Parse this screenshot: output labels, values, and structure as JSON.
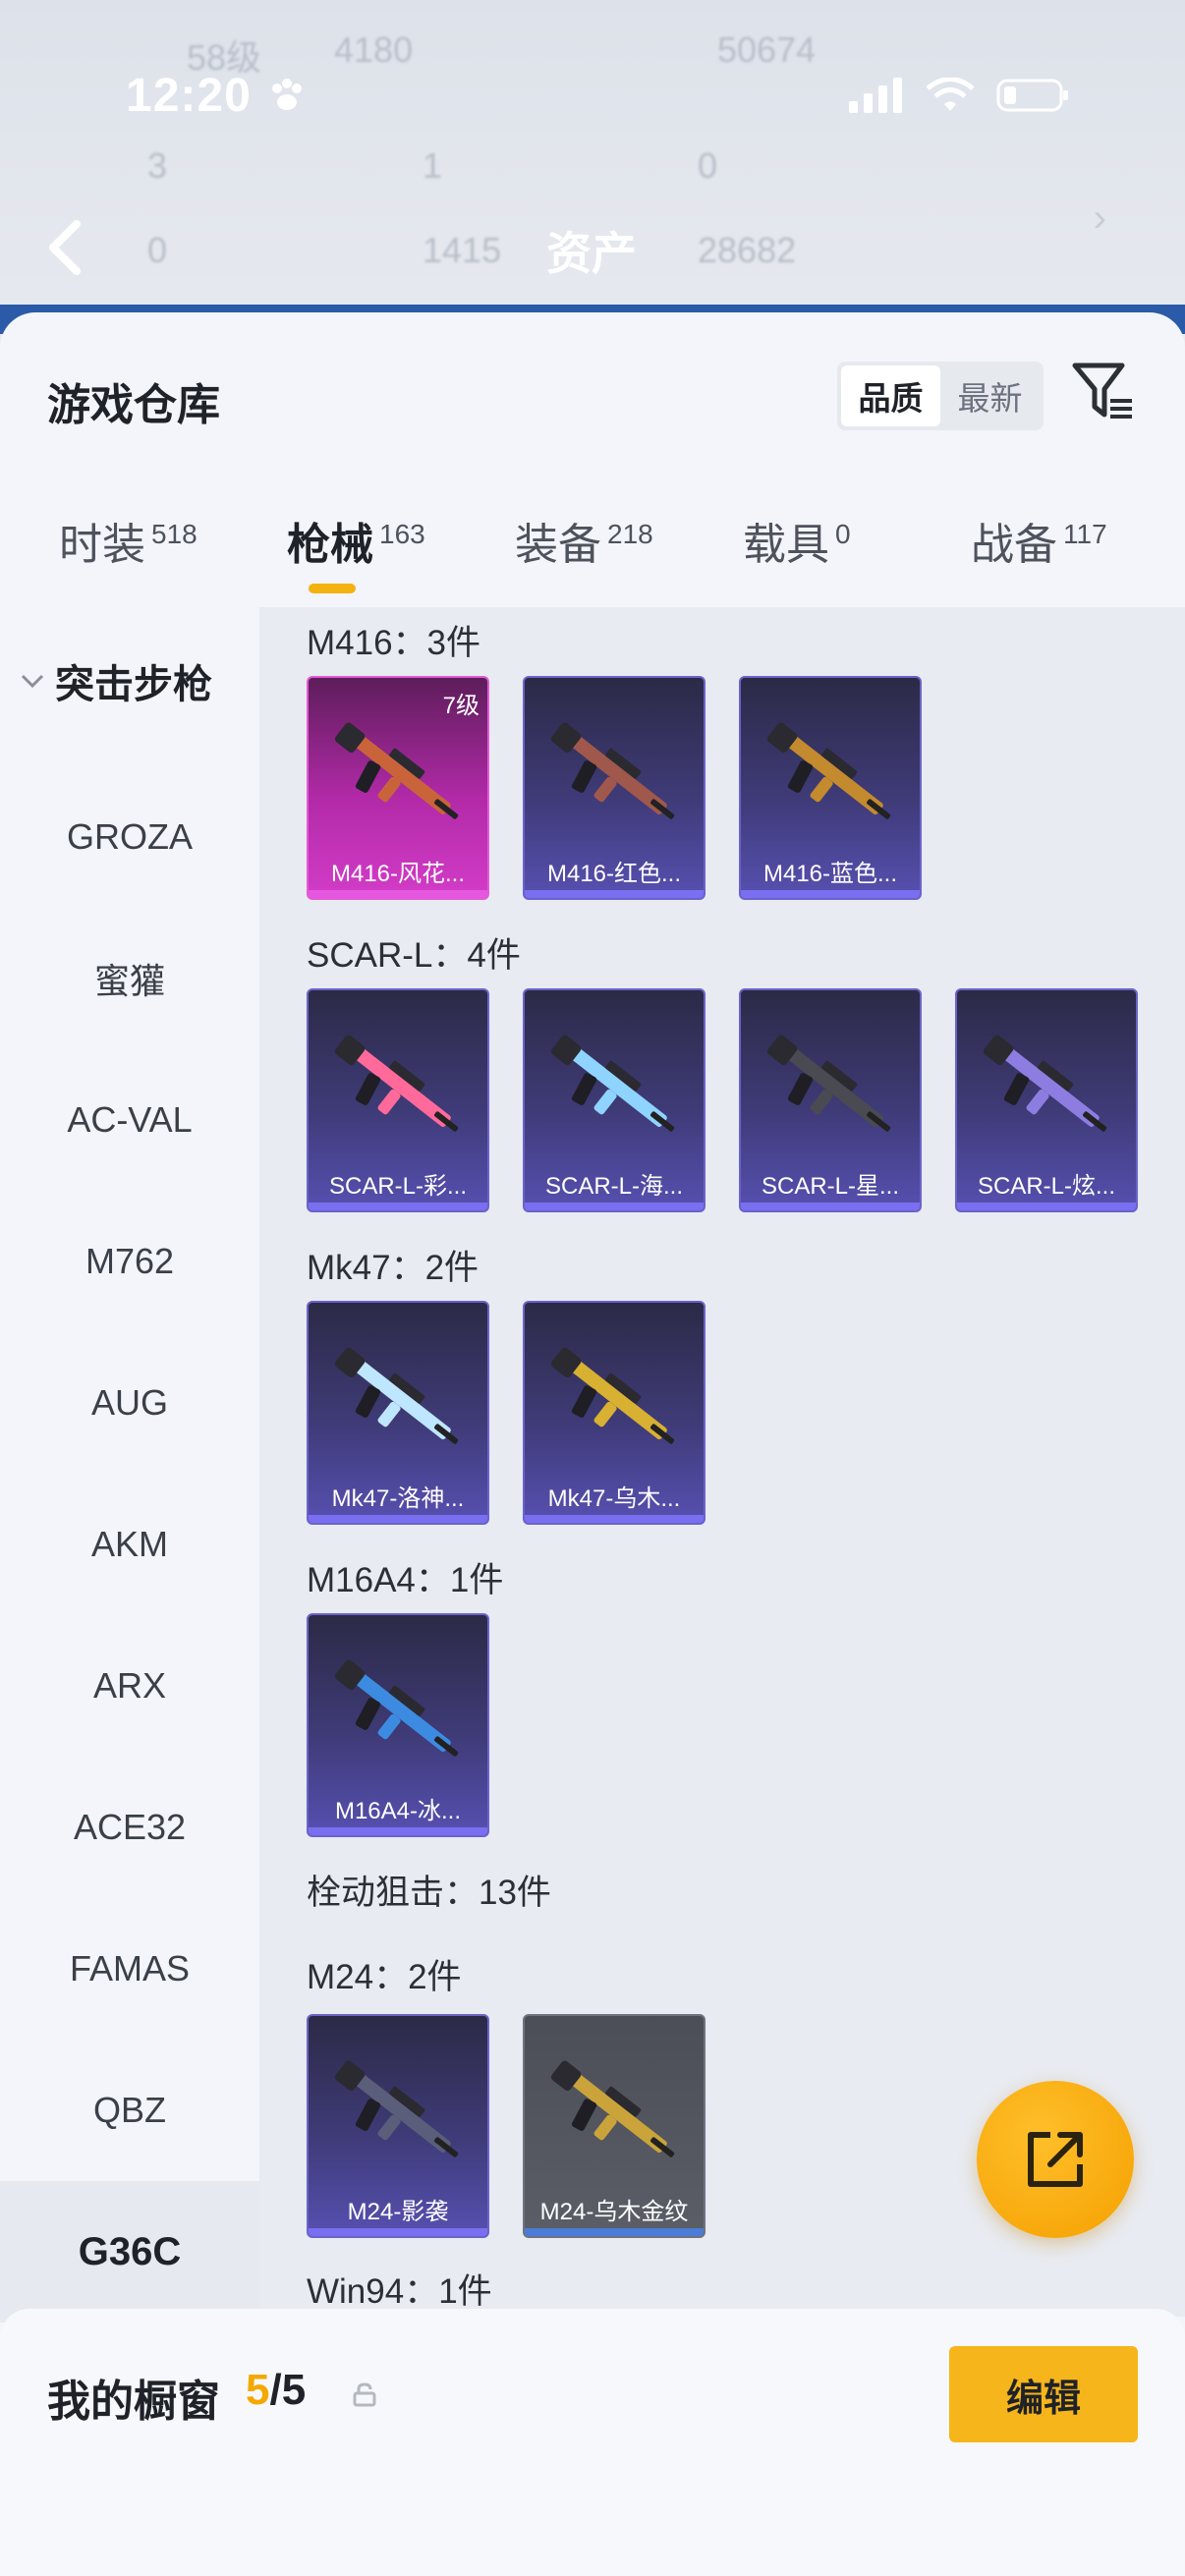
{
  "status_bar": {
    "time": "12:20"
  },
  "background_header": {
    "title": "资产",
    "row1": [
      "58级",
      "4180",
      "50674"
    ],
    "row2": [
      "3",
      "1",
      "0"
    ],
    "row3": [
      "0",
      "1415",
      "28682"
    ]
  },
  "sheet": {
    "title": "游戏仓库",
    "sort_options": [
      "品质",
      "最新"
    ],
    "sort_active": "品质"
  },
  "tabs": [
    {
      "label": "时装",
      "count": "518"
    },
    {
      "label": "枪械",
      "count": "163"
    },
    {
      "label": "装备",
      "count": "218"
    },
    {
      "label": "载具",
      "count": "0"
    },
    {
      "label": "战备",
      "count": "117"
    }
  ],
  "sidebar": {
    "group": "突击步枪",
    "items": [
      "GROZA",
      "蜜獾",
      "AC-VAL",
      "M762",
      "AUG",
      "AKM",
      "ARX",
      "ACE32",
      "FAMAS",
      "QBZ",
      "G36C"
    ],
    "active": "G36C"
  },
  "sections": [
    {
      "label": "M416：3件",
      "cards": [
        {
          "name": "M416-风花...",
          "grade": "7级",
          "style": "pink",
          "gun_color": "#c9643a"
        },
        {
          "name": "M416-红色...",
          "style": "purple",
          "gun_color": "#a0584c"
        },
        {
          "name": "M416-蓝色...",
          "style": "purple",
          "gun_color": "#c48a2e"
        }
      ]
    },
    {
      "label": "SCAR-L：4件",
      "cards": [
        {
          "name": "SCAR-L-彩...",
          "style": "purple",
          "gun_color": "#ff6a9a"
        },
        {
          "name": "SCAR-L-海...",
          "style": "purple",
          "gun_color": "#8fd3ff"
        },
        {
          "name": "SCAR-L-星...",
          "style": "purple",
          "gun_color": "#4a4a52"
        },
        {
          "name": "SCAR-L-炫...",
          "style": "purple",
          "gun_color": "#8e7de0"
        }
      ]
    },
    {
      "label": "Mk47：2件",
      "cards": [
        {
          "name": "Mk47-洛神...",
          "style": "purple",
          "gun_color": "#bfe6ff"
        },
        {
          "name": "Mk47-乌木...",
          "style": "purple",
          "gun_color": "#d8b032"
        }
      ]
    },
    {
      "label": "M16A4：1件",
      "cards": [
        {
          "name": "M16A4-冰...",
          "style": "purple",
          "gun_color": "#3d8be0"
        }
      ]
    },
    {
      "label": "栓动狙击：13件",
      "cards": []
    },
    {
      "label": "M24：2件",
      "cards": [
        {
          "name": "M24-影袭",
          "style": "purple",
          "gun_color": "#5a5e7a"
        },
        {
          "name": "M24-乌木金纹",
          "style": "grey",
          "gun_color": "#caa43a"
        }
      ]
    },
    {
      "label": "Win94：1件",
      "cards": []
    }
  ],
  "bottom": {
    "showcase_label": "我的橱窗",
    "current": "5",
    "total": "/5",
    "edit_label": "编辑"
  },
  "colors": {
    "accent": "#f6b51a",
    "brand_blue": "#2a5aa8"
  }
}
